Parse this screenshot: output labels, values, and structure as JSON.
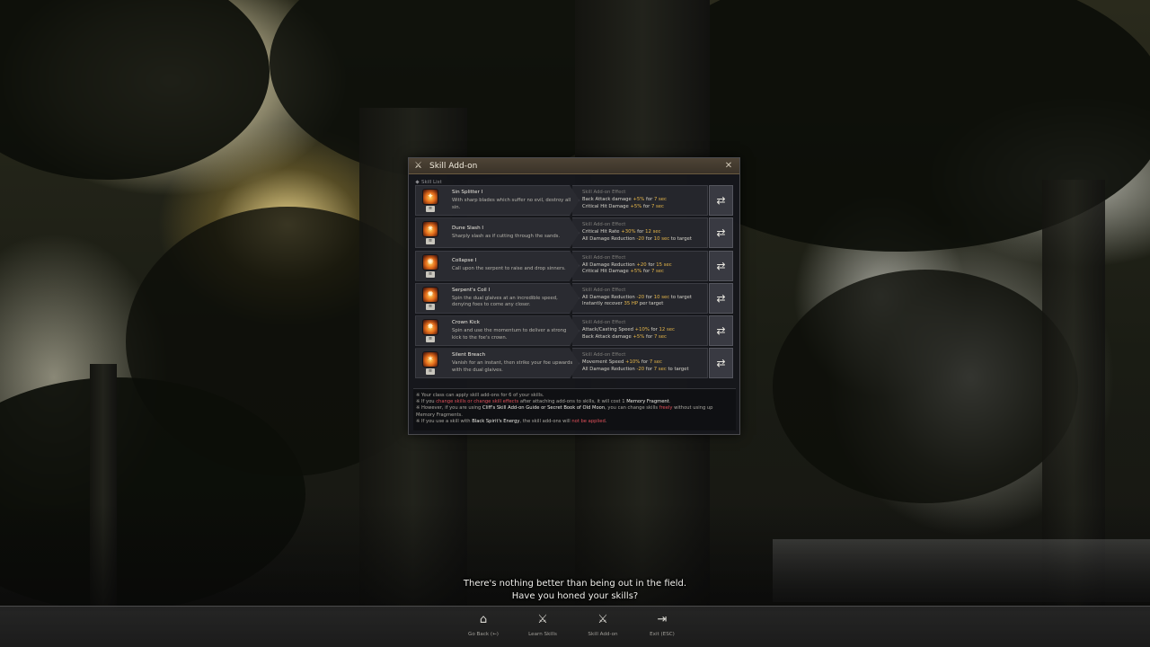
{
  "dialog": {
    "title": "Skill Add-on",
    "title_icon": "crossed-swords-icon",
    "close_icon": "close-icon",
    "section_label": "Skill List",
    "effect_heading": "Skill Add-on Effect",
    "skills": [
      {
        "name": "Sin Splitter I",
        "description": "With sharp blades which suffer no evil, destroy all sin.",
        "effects": [
          {
            "text": "Back Attack damage ",
            "value": "+5%",
            "suffix": " for ",
            "dur": "7 sec",
            "tail": ""
          },
          {
            "text": "Critical Hit Damage ",
            "value": "+5%",
            "suffix": " for ",
            "dur": "7 sec",
            "tail": ""
          }
        ]
      },
      {
        "name": "Dune Slash I",
        "description": "Sharply slash as if cutting through the sands.",
        "effects": [
          {
            "text": "Critical Hit Rate ",
            "value": "+30%",
            "suffix": " for ",
            "dur": "12 sec",
            "tail": ""
          },
          {
            "text": "All Damage Reduction ",
            "value": "-20",
            "suffix": " for ",
            "dur": "10 sec",
            "tail": " to target"
          }
        ]
      },
      {
        "name": "Collapse I",
        "description": "Call upon the serpent to raise and drop sinners.",
        "effects": [
          {
            "text": "All Damage Reduction ",
            "value": "+20",
            "suffix": " for ",
            "dur": "15 sec",
            "tail": ""
          },
          {
            "text": "Critical Hit Damage ",
            "value": "+5%",
            "suffix": " for ",
            "dur": "7 sec",
            "tail": ""
          }
        ]
      },
      {
        "name": "Serpent's Coil I",
        "description": "Spin the dual glaives at an incredible speed, denying foes to come any closer.",
        "effects": [
          {
            "text": "All Damage Reduction ",
            "value": "-20",
            "suffix": " for ",
            "dur": "10 sec",
            "tail": " to target"
          },
          {
            "text": "Instantly recover ",
            "value": "35 HP",
            "suffix": " per target",
            "dur": "",
            "tail": ""
          }
        ]
      },
      {
        "name": "Crown Kick",
        "description": "Spin and use the momentum to deliver a strong kick to the foe's crown.",
        "effects": [
          {
            "text": "Attack/Casting Speed ",
            "value": "+10%",
            "suffix": " for ",
            "dur": "12 sec",
            "tail": ""
          },
          {
            "text": "Back Attack damage ",
            "value": "+5%",
            "suffix": " for ",
            "dur": "7 sec",
            "tail": ""
          }
        ]
      },
      {
        "name": "Silent Breach",
        "description": "Vanish for an instant, then strike your foe upwards with the dual glaives.",
        "effects": [
          {
            "text": "Movement Speed ",
            "value": "+10%",
            "suffix": " for ",
            "dur": "7 sec",
            "tail": ""
          },
          {
            "text": "All Damage Reduction ",
            "value": "-20",
            "suffix": " for ",
            "dur": "7 sec",
            "tail": " to target"
          }
        ]
      }
    ],
    "notes": [
      {
        "parts": [
          {
            "t": "※ Your class can apply skill add-ons for 6 of your skills.",
            "c": ""
          }
        ]
      },
      {
        "parts": [
          {
            "t": "※ If you ",
            "c": ""
          },
          {
            "t": "change skills or change skill effects",
            "c": "red"
          },
          {
            "t": " after attaching add-ons to skills, it will cost 1 ",
            "c": ""
          },
          {
            "t": "Memory Fragment",
            "c": "white"
          },
          {
            "t": ".",
            "c": ""
          }
        ]
      },
      {
        "parts": [
          {
            "t": "※ However, if you are using ",
            "c": ""
          },
          {
            "t": "Cliff's Skill Add-on Guide or Secret Book of Old Moon",
            "c": "white"
          },
          {
            "t": ", you can change skills ",
            "c": ""
          },
          {
            "t": "freely",
            "c": "red"
          },
          {
            "t": " without using up Memory Fragments.",
            "c": ""
          }
        ]
      },
      {
        "parts": [
          {
            "t": "※ If you use a skill with ",
            "c": ""
          },
          {
            "t": "Black Spirit's Energy",
            "c": "white"
          },
          {
            "t": ", the skill add-ons will ",
            "c": ""
          },
          {
            "t": "not be applied",
            "c": "red"
          },
          {
            "t": ".",
            "c": ""
          }
        ]
      }
    ]
  },
  "subtitle": {
    "line1": "There's nothing better than being out in the field.",
    "line2": "Have you honed your skills?"
  },
  "bottom_bar": {
    "buttons": [
      {
        "label": "Go Back (←)",
        "icon": "home-icon"
      },
      {
        "label": "Learn Skills",
        "icon": "crossed-swords-icon"
      },
      {
        "label": "Skill Add-on",
        "icon": "crossed-swords-icon"
      },
      {
        "label": "Exit (ESC)",
        "icon": "exit-icon"
      }
    ]
  },
  "colors": {
    "accent_value": "#e8b84a",
    "warning_red": "#e0505a",
    "title_bar": "#4e4436"
  }
}
